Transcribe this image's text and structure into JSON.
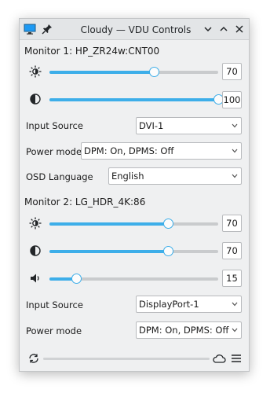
{
  "window": {
    "title": "Cloudy — VDU Controls",
    "icons": [
      "monitor-icon",
      "pin-icon",
      "minimize-icon",
      "maximize-icon",
      "close-icon"
    ]
  },
  "monitor1": {
    "title": "Monitor 1: HP_ZR24w:CNT00",
    "brightness": "70",
    "brightness_level": 0.62,
    "contrast": "100",
    "contrast_level": 1.0,
    "input_label": "Input Source",
    "input_value": "DVI-1",
    "power_label": "Power mode",
    "power_value": "DPM: On,  DPMS: Off",
    "osd_label": "OSD Language",
    "osd_value": "English"
  },
  "monitor2": {
    "title": "Monitor 2: LG_HDR_4K:86",
    "brightness": "70",
    "brightness_level": 0.7,
    "contrast": "70",
    "contrast_level": 0.7,
    "volume": "15",
    "volume_level": 0.16,
    "input_label": "Input Source",
    "input_value": "DisplayPort-1",
    "power_label": "Power mode",
    "power_value": "DPM: On,  DPMS: Off"
  },
  "bottom": {
    "icons": [
      "refresh-icon",
      "cloud-icon",
      "menu-icon"
    ]
  },
  "colors": {
    "accent": "#3daee9",
    "window_bg": "#eff0f1",
    "titlebar_bg": "#e3e5e7"
  }
}
